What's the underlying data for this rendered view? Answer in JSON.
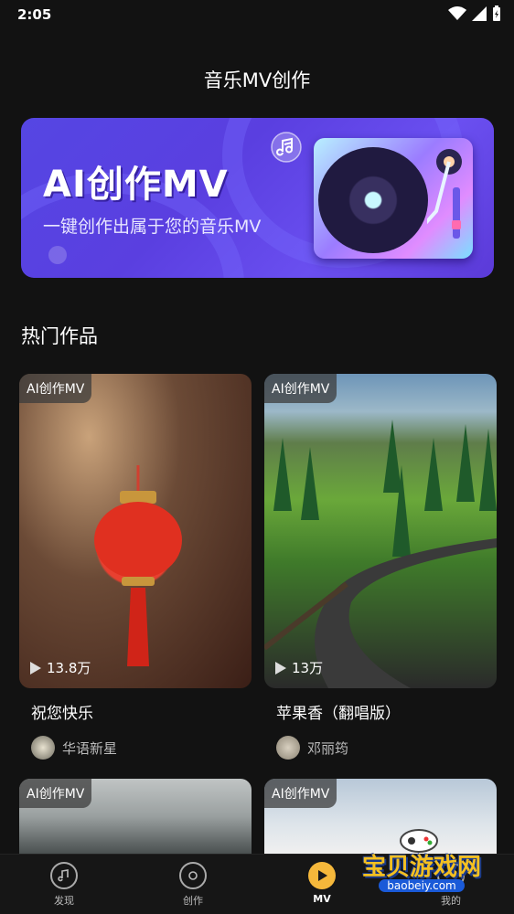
{
  "status_bar": {
    "time": "2:05"
  },
  "header": {
    "title": "音乐MV创作"
  },
  "banner": {
    "headline": "AI创作MV",
    "subtitle": "一键创作出属于您的音乐MV"
  },
  "hot_section": {
    "title": "热门作品"
  },
  "cards": [
    {
      "tag": "AI创作MV",
      "plays": "13.8万",
      "title": "祝您快乐",
      "author": "华语新星"
    },
    {
      "tag": "AI创作MV",
      "plays": "13万",
      "title": "苹果香（翻唱版）",
      "author": "邓丽筠"
    },
    {
      "tag": "AI创作MV"
    },
    {
      "tag": "AI创作MV"
    }
  ],
  "nav": {
    "discover": "发现",
    "create": "创作",
    "mv": "MV",
    "mine": "我的"
  },
  "watermark": {
    "brand": "宝贝游戏网",
    "url": "baobeiy.com"
  },
  "colors": {
    "background": "#121212",
    "accent": "#f5b83b",
    "banner": "#5a3fe0"
  }
}
